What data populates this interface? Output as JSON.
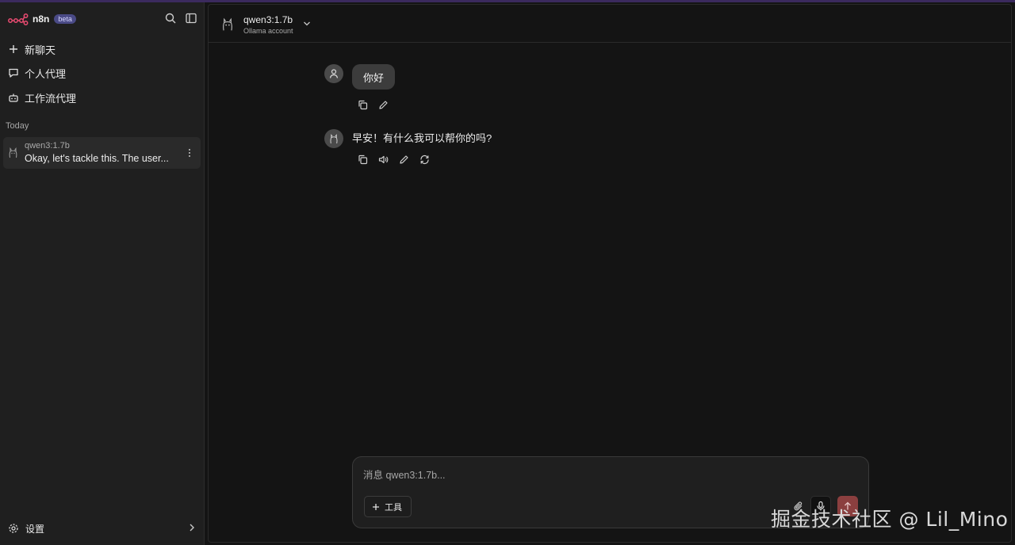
{
  "brand": {
    "name": "n8n",
    "badge": "beta",
    "logo_color": "#ea4b71"
  },
  "sidebar": {
    "nav": [
      {
        "label": "新聊天",
        "icon": "plus-icon"
      },
      {
        "label": "个人代理",
        "icon": "chat-bubble-icon"
      },
      {
        "label": "工作流代理",
        "icon": "robot-icon"
      }
    ],
    "section_label": "Today",
    "chats": [
      {
        "title": "qwen3:1.7b",
        "preview": "Okay, let's tackle this. The user..."
      }
    ],
    "settings_label": "设置"
  },
  "header": {
    "model_name": "qwen3:1.7b",
    "account": "Ollama account"
  },
  "messages": {
    "user": {
      "text": "你好"
    },
    "assistant": {
      "text": "早安！有什么我可以帮你的吗?"
    }
  },
  "composer": {
    "placeholder": "消息 qwen3:1.7b...",
    "tools_label": "工具"
  },
  "watermark": "掘金技术社区 @ Lil_Mino",
  "colors": {
    "send_button": "#8b3f3f",
    "badge_bg": "#4a4a86",
    "background": "#141414",
    "sidebar_bg": "#1f1f1f"
  }
}
